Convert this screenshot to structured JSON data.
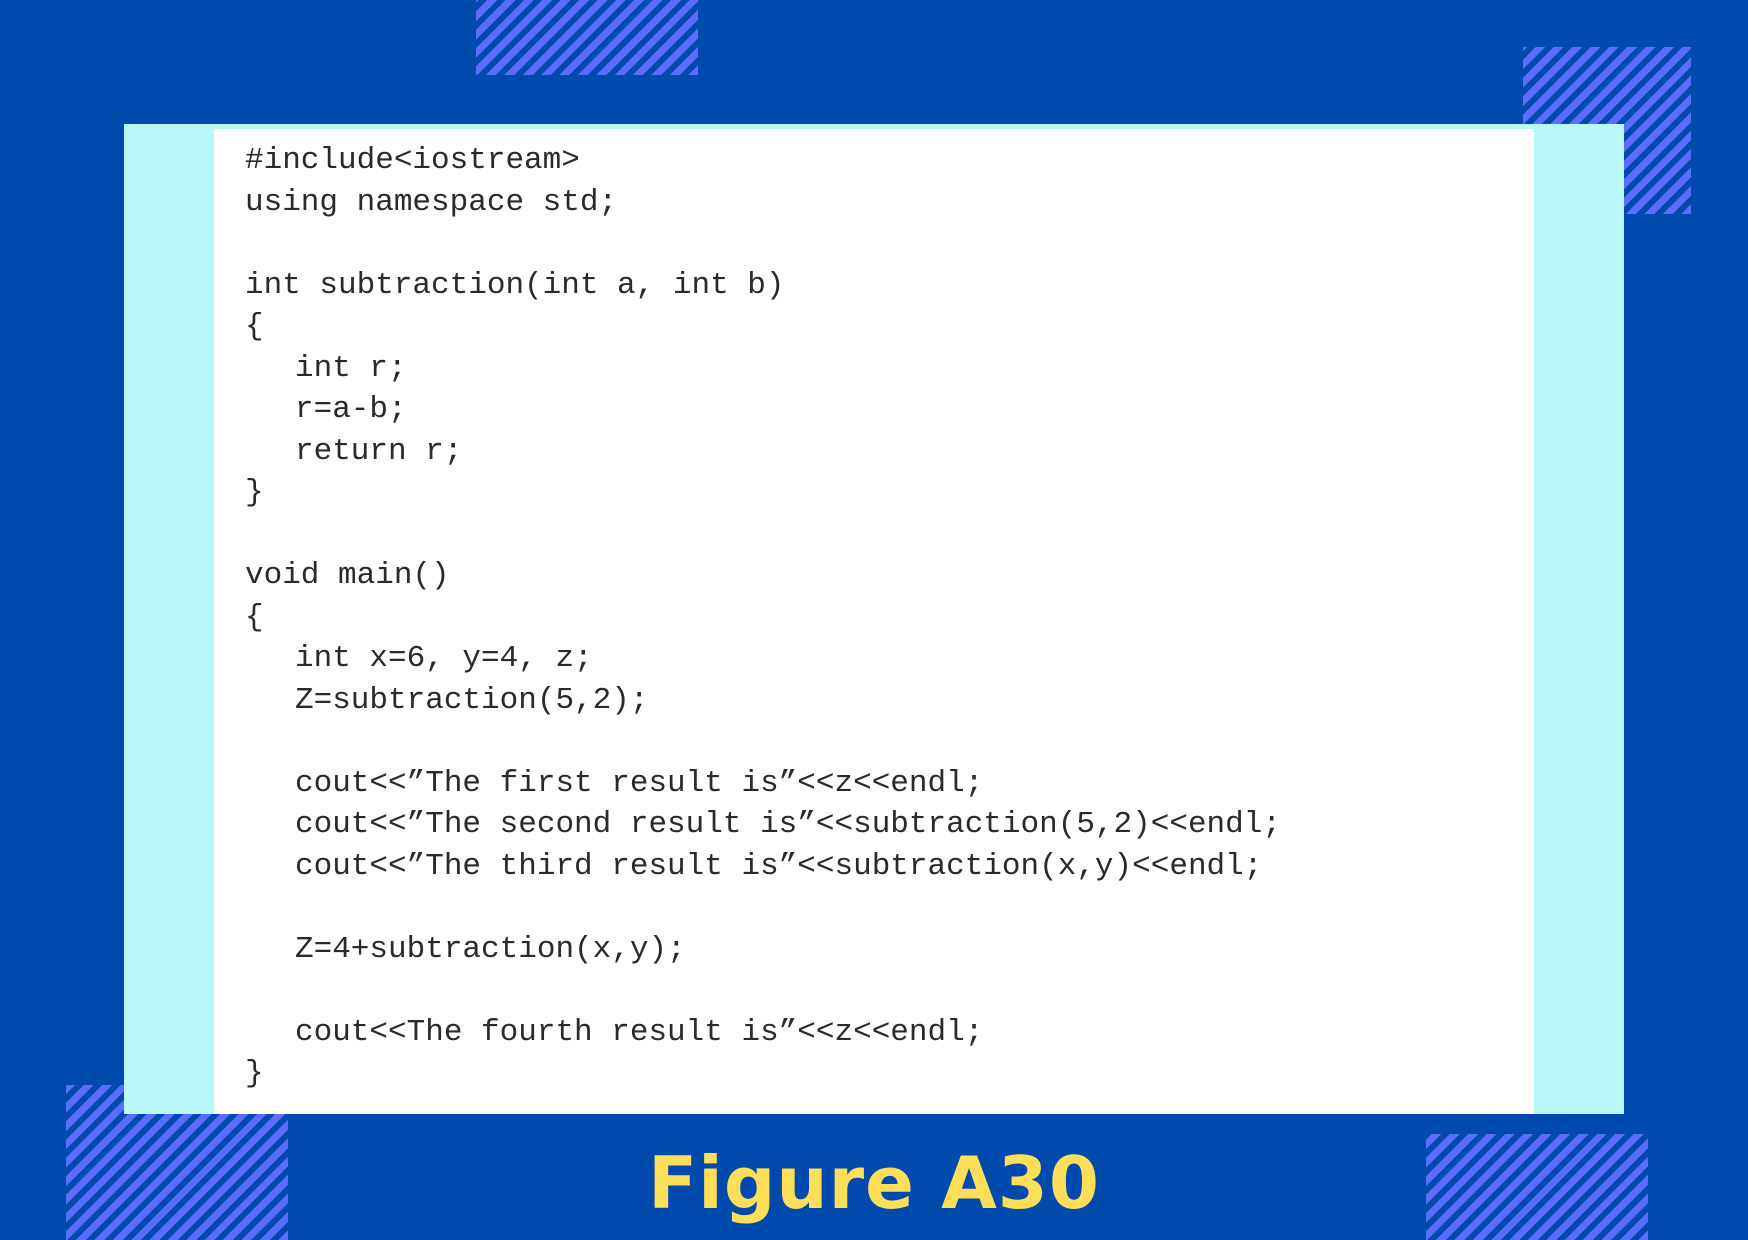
{
  "figure": {
    "caption": "Figure A30"
  },
  "code_lines": [
    "#include<iostream>",
    "using namespace std;",
    "",
    "int subtraction(int a, int b)",
    "{",
    "int r;",
    "r=a-b;",
    "return r;",
    "}",
    "",
    "void main()",
    "{",
    "int x=6, y=4, z;",
    "Z=subtraction(5,2);",
    "",
    "cout<<”The first result is”<<z<<endl;",
    "cout<<”The second result is”<<subtraction(5,2)<<endl;",
    "cout<<”The third result is”<<subtraction(x,y)<<endl;",
    "",
    "Z=4+subtraction(x,y);",
    "",
    "cout<<The fourth result is”<<z<<endl;",
    "}"
  ],
  "colors": {
    "background": "#004aad",
    "panel": "#b8f8fb",
    "stripe": "#5b6cff",
    "caption": "#ffde59"
  }
}
